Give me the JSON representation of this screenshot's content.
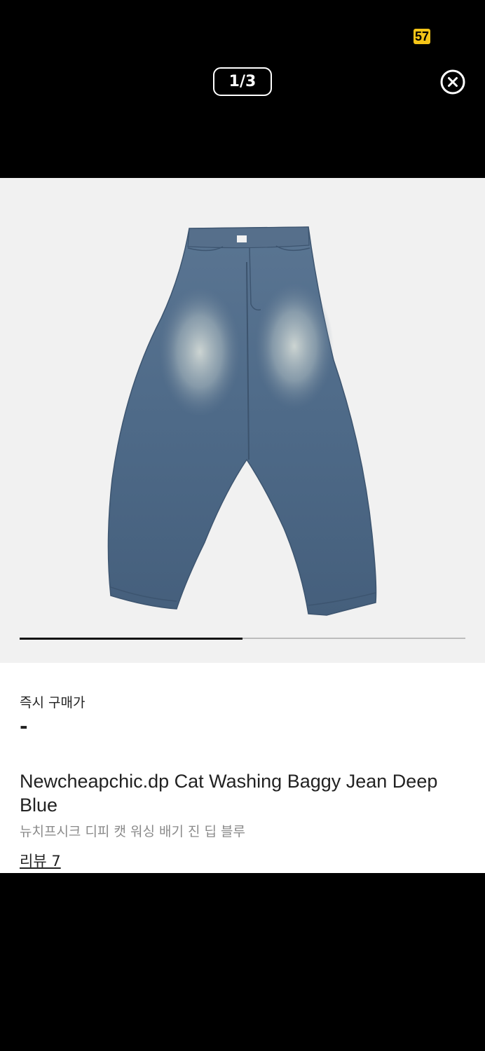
{
  "status_bar": {
    "badge_text": "57"
  },
  "header": {
    "pager_text": "1/3",
    "close_icon": "close-circle-icon"
  },
  "gallery": {
    "current_index": 1,
    "total": 3,
    "progress_fraction": 0.5,
    "image_subject": "baggy-jeans-image"
  },
  "product": {
    "price_label": "즉시 구매가",
    "price_value": "-",
    "title": "Newcheapchic.dp Cat Washing Baggy Jean Deep Blue",
    "subtitle": "뉴치프시크 디피 캣 워싱 배기 진 딥 블루",
    "review_link": "리뷰 7"
  },
  "colors": {
    "background": "#000000",
    "gallery_bg": "#F1F1F1",
    "badge": "#F5C518",
    "text": "#222222",
    "subtext": "#8A8A8A",
    "progress_track": "#BDBDBD",
    "progress_fill": "#111111",
    "denim": "#4E6A88"
  }
}
